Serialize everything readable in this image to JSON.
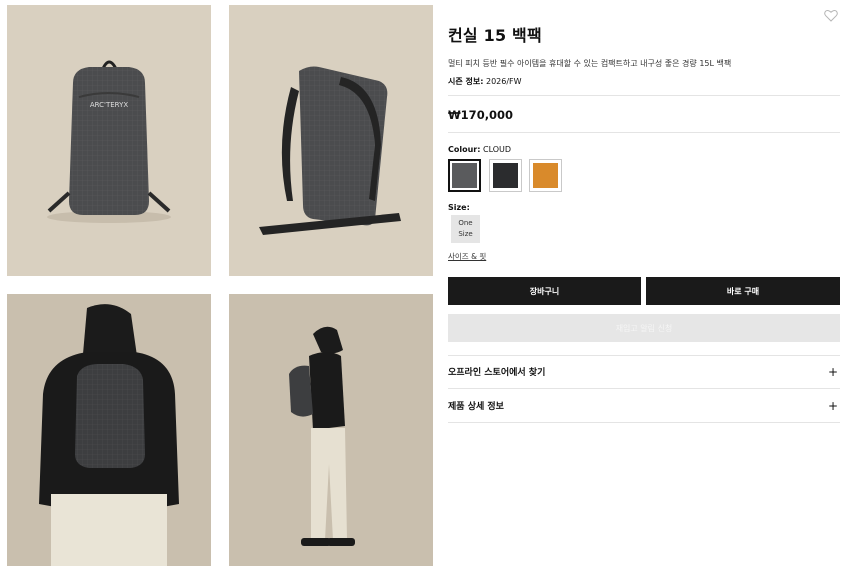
{
  "gallery": {
    "images": [
      {
        "name": "backpack-front"
      },
      {
        "name": "backpack-back"
      },
      {
        "name": "model-back-view"
      },
      {
        "name": "model-side-view"
      }
    ]
  },
  "product": {
    "title": "컨실 15 백팩",
    "subtitle": "멀티 피치 등반 필수 아이템을 휴대할 수 있는 컴팩트하고 내구성 좋은 경량 15L 백팩",
    "season_label": "시즌 정보:",
    "season_value": "2026/FW",
    "price": "₩170,000"
  },
  "colour": {
    "label": "Colour:",
    "selected": "CLOUD",
    "swatches": [
      {
        "name": "cloud",
        "hex": "#5a5b5d",
        "selected": true
      },
      {
        "name": "black",
        "hex": "#2b2c2e",
        "selected": false
      },
      {
        "name": "orange",
        "hex": "#d98a2b",
        "selected": false
      }
    ]
  },
  "size": {
    "label": "Size:",
    "options": [
      {
        "line1": "One",
        "line2": "Size"
      }
    ],
    "guide_link": "사이즈 & 핏"
  },
  "actions": {
    "cart_label": "장바구니",
    "buy_label": "바로 구매",
    "notify_label": "재입고 알림 신청"
  },
  "accordion": [
    {
      "label": "오프라인 스토어에서 찾기",
      "icon": "plus-icon"
    },
    {
      "label": "제품 상세 정보",
      "icon": "plus-icon"
    }
  ],
  "wishlist_icon": "heart-icon"
}
